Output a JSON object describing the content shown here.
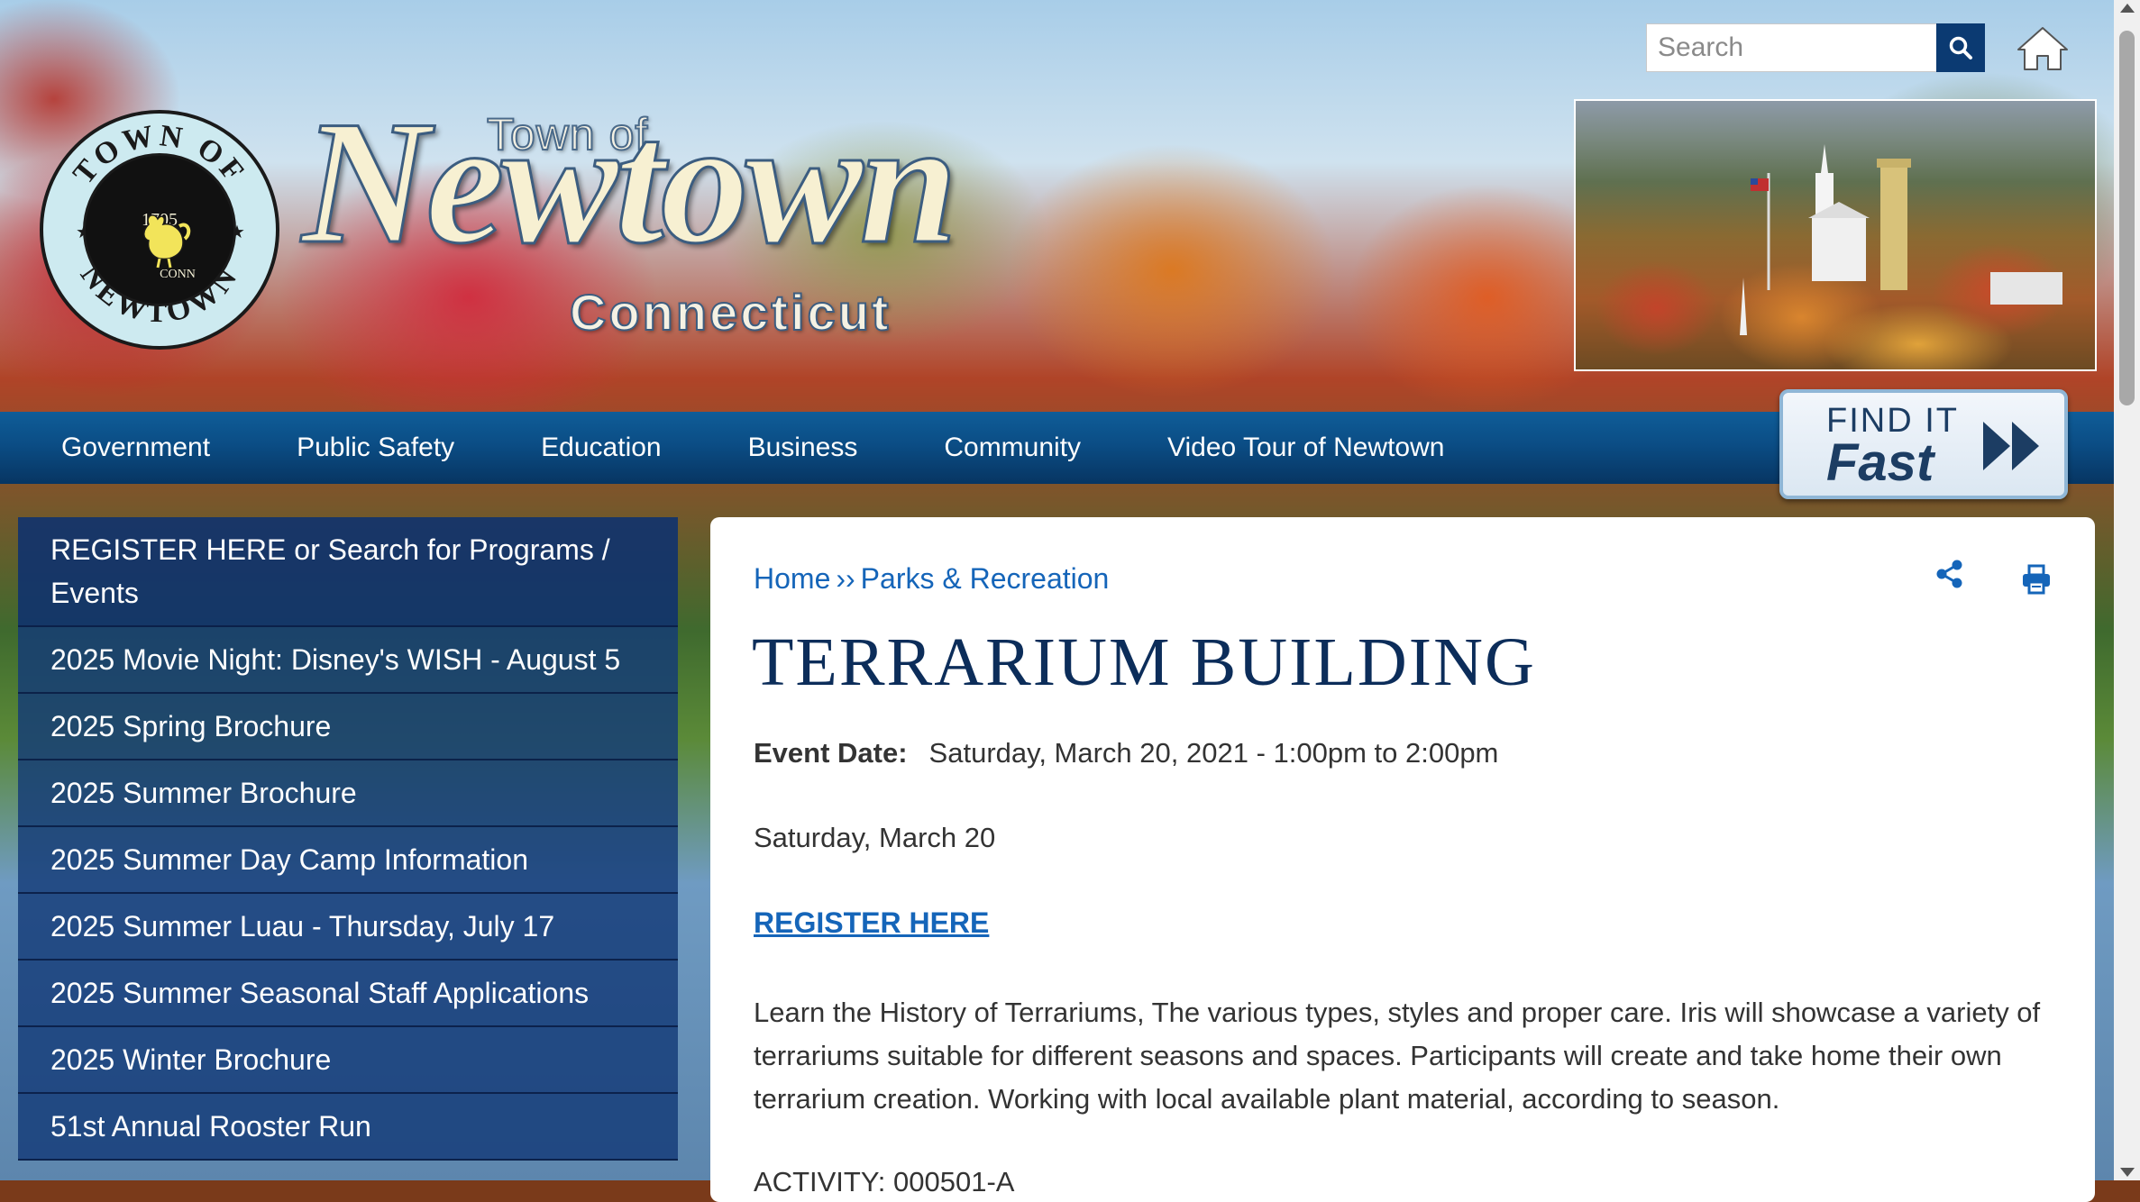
{
  "header": {
    "seal": {
      "top_text": "TOWN OF",
      "bottom_text": "NEWTOWN",
      "year": "1705",
      "conn": "CONN"
    },
    "wordmark": {
      "top": "Town of",
      "main": "Newtown",
      "sub": "Connecticut"
    },
    "search": {
      "placeholder": "Search",
      "value": ""
    },
    "icons": {
      "search": "search-icon",
      "home": "home-icon"
    }
  },
  "nav": {
    "items": [
      "Government",
      "Public Safety",
      "Education",
      "Business",
      "Community",
      "Video Tour of Newtown"
    ],
    "find_it": {
      "line1": "FIND IT",
      "line2": "Fast"
    }
  },
  "sidebar": {
    "items": [
      "REGISTER HERE or Search for Programs / Events",
      "2025 Movie Night: Disney's WISH - August 5",
      "2025 Spring Brochure",
      "2025 Summer Brochure",
      "2025 Summer Day Camp Information",
      "2025 Summer Luau - Thursday, July 17",
      "2025 Summer Seasonal Staff Applications",
      "2025 Winter Brochure",
      "51st Annual Rooster Run"
    ]
  },
  "main": {
    "breadcrumb": {
      "home": "Home",
      "separator": "››",
      "current": "Parks & Recreation"
    },
    "title": "TERRARIUM BUILDING",
    "event_date_label": "Event Date:",
    "event_date_value": "Saturday, March 20, 2021 - 1:00pm to 2:00pm",
    "paragraph1": "Saturday, March 20",
    "register_link": "REGISTER HERE",
    "description": "Learn the History of Terrariums, The various types, styles and proper care. Iris will showcase a variety of terrariums suitable for different seasons and spaces. Participants will create and take home their own terrarium creation. Working with local available plant material, according to season.",
    "activity": "ACTIVITY: 000501-A"
  },
  "colors": {
    "nav_blue": "#0b4d85",
    "link_blue": "#1565b9",
    "title_navy": "#0c2d5a",
    "sidebar_blue": "#143a78"
  }
}
